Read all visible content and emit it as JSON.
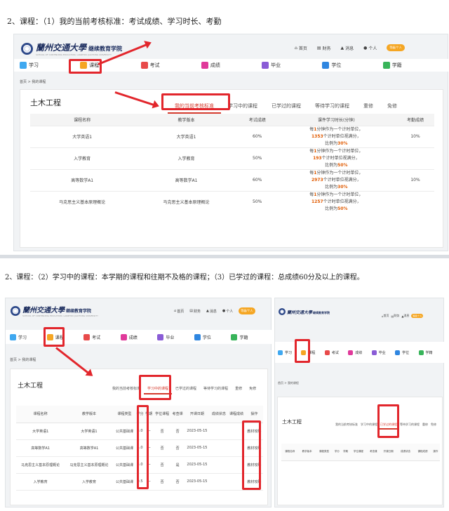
{
  "captions": {
    "first": "2、课程：（1）我的当前考核标准：考试成绩、学习时长、考勤",
    "second": "2、课程：（2）学习中的课程：本学期的课程和往期不及格的课程；（3）已学过的课程：总成绩60分及以上的课程。"
  },
  "brand": {
    "name": "蘭州交通大學",
    "subtitle": "继续教育学院",
    "english": "SCHOOL OF CONTINUING EDUCATION, LANZHOU JIAOTONG UNIVERSITY"
  },
  "toplinks": {
    "home": "首页",
    "finance": "财务",
    "message": "消息",
    "personal": "个人",
    "user_badge": "等级/个人"
  },
  "nav": [
    {
      "label": "学习",
      "color": "#3fa8f0"
    },
    {
      "label": "课程",
      "color": "#f5a623"
    },
    {
      "label": "考试",
      "color": "#e84a4a"
    },
    {
      "label": "成绩",
      "color": "#e0399a"
    },
    {
      "label": "毕业",
      "color": "#8a5cd6"
    },
    {
      "label": "学位",
      "color": "#2f86e0"
    },
    {
      "label": "学籍",
      "color": "#38b45a"
    }
  ],
  "breadcrumb": "首页 > 我的课程",
  "course_name": "土木工程",
  "tabs": [
    "我的当前考核标准",
    "学习中的课程",
    "已学过的课程",
    "等待学习的课程",
    "重修",
    "免修"
  ],
  "standards": {
    "headers": [
      "课程名称",
      "教学版本",
      "考试成绩",
      "课件学习时长(分钟)",
      "考勤成绩"
    ],
    "rows": [
      {
        "name": "大学英语1",
        "version": "大学英语1",
        "exam": "60%",
        "minutes": "1353",
        "attendance": "10%"
      },
      {
        "name": "入学教育",
        "version": "入学教育",
        "exam": "50%",
        "minutes": "193",
        "attendance": ""
      },
      {
        "name": "高等数学A1",
        "version": "高等数学A1",
        "exam": "60%",
        "minutes": "2973",
        "attendance": "10%"
      },
      {
        "name": "马克思主义基本原理概论",
        "version": "马克思主义基本原理概论",
        "exam": "50%",
        "minutes": "1257",
        "attendance": ""
      }
    ],
    "rule": {
      "p1": "每",
      "p2": "1",
      "p3": "分钟作为一个计时单位，",
      "p4": "个计时单位视满分，",
      "p5": "比例为",
      "p6": "50%",
      "p7": "30%"
    }
  },
  "learning": {
    "headers": [
      "课程名称",
      "教学版本",
      "课程类型",
      "学分",
      "学期",
      "学位课程",
      "考查课",
      "开课日期",
      "成绩状态",
      "课程成绩",
      "操作"
    ],
    "rows": [
      {
        "name": "大学英语1",
        "version": "大学英语1",
        "type": "公共基础课",
        "credit": "3.0",
        "term": "一",
        "degree": "否",
        "check": "否",
        "date": "2023-05-15",
        "op": "教材攻略"
      },
      {
        "name": "高等数学A1",
        "version": "高等数学A1",
        "type": "公共基础课",
        "credit": "5.0",
        "term": "一",
        "degree": "否",
        "check": "否",
        "date": "2023-05-15",
        "op": "教材攻略"
      },
      {
        "name": "马克思主义基本原理概论",
        "version": "马克思主义基本原理概论",
        "type": "公共基础课",
        "credit": "3.0",
        "term": "一",
        "degree": "否",
        "check": "是",
        "date": "2023-05-15",
        "op": "教材攻略"
      },
      {
        "name": "入学教育",
        "version": "入学教育",
        "type": "公共基础课",
        "credit": "0.5",
        "term": "一",
        "degree": "否",
        "check": "否",
        "date": "2023-05-15",
        "op": "教材攻略"
      }
    ]
  },
  "learned_headers": [
    "课程名称",
    "教学版本",
    "课程类型",
    "学分",
    "学期",
    "学位课程",
    "考查课",
    "开课日期",
    "成绩状态",
    "课程成绩",
    "操作"
  ]
}
